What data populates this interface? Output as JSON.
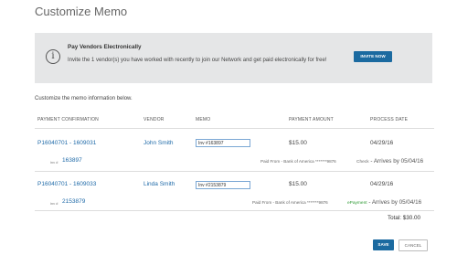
{
  "page": {
    "title": "Customize Memo"
  },
  "banner": {
    "icon": "info-icon",
    "icon_glyph": "i",
    "heading": "Pay Vendors Electronically",
    "text": "Invite the 1 vendor(s) you have worked with recently to join our Network and get paid electronically for free!",
    "button_label": "INVITE NOW"
  },
  "instructions": "Customize the memo information below.",
  "columns": {
    "confirmation": "PAYMENT CONFIRMATION",
    "vendor": "VENDOR",
    "memo": "MEMO",
    "amount": "PAYMENT AMOUNT",
    "date": "PROCESS DATE"
  },
  "payments": [
    {
      "confirmation": "P16040701 - 1609031",
      "vendor": "John Smith",
      "memo": "Inv #163897",
      "amount": "$15.00",
      "process_date": "04/29/16",
      "invoice_label": "inv #",
      "invoice": "163897",
      "paid_from": "Paid From - Bank of America *******9876",
      "method": "Check",
      "arrives": " - Arrives by 05/04/16"
    },
    {
      "confirmation": "P16040701 - 1609033",
      "vendor": "Linda Smith",
      "memo": "Inv #2153879",
      "amount": "$15.00",
      "process_date": "04/29/16",
      "invoice_label": "inv #",
      "invoice": "2153879",
      "paid_from": "Paid From - Bank of America *******9876",
      "method": "ePayment",
      "arrives": " - Arrives by 05/04/16"
    }
  ],
  "total": "Total: $30.00",
  "buttons": {
    "save": "SAVE",
    "cancel": "CANCEL"
  },
  "colors": {
    "accent": "#1b6aa0",
    "link": "#1f6aa8",
    "epayment": "#2f9a35",
    "banner_bg": "#e5e6e7"
  }
}
